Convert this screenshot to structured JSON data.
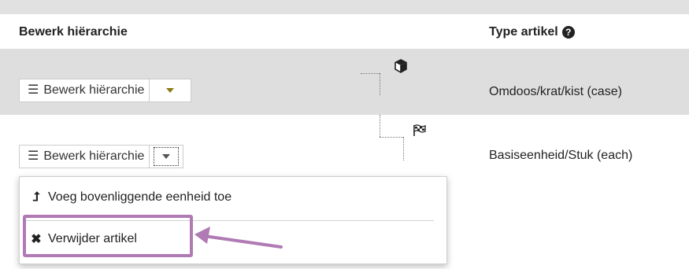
{
  "header": {
    "col_hierarchy": "Bewerk hiërarchie",
    "col_type": "Type artikel",
    "help_icon": "?"
  },
  "rows": [
    {
      "button_label": "Bewerk hiërarchie",
      "type": "Omdoos/krat/kist (case)",
      "icon": "cube-icon"
    },
    {
      "button_label": "Bewerk hiërarchie",
      "type": "Basiseenheid/Stuk (each)",
      "icon": "flag-icon"
    }
  ],
  "dropdown": {
    "items": [
      {
        "label": "Voeg bovenliggende eenheid toe",
        "icon": "level-up-icon"
      },
      {
        "label": "Verwijder artikel",
        "icon": "times-icon"
      }
    ]
  },
  "colors": {
    "highlight": "#b07ab4",
    "row_shaded": "#dedede",
    "caret": "#8a7a16"
  }
}
